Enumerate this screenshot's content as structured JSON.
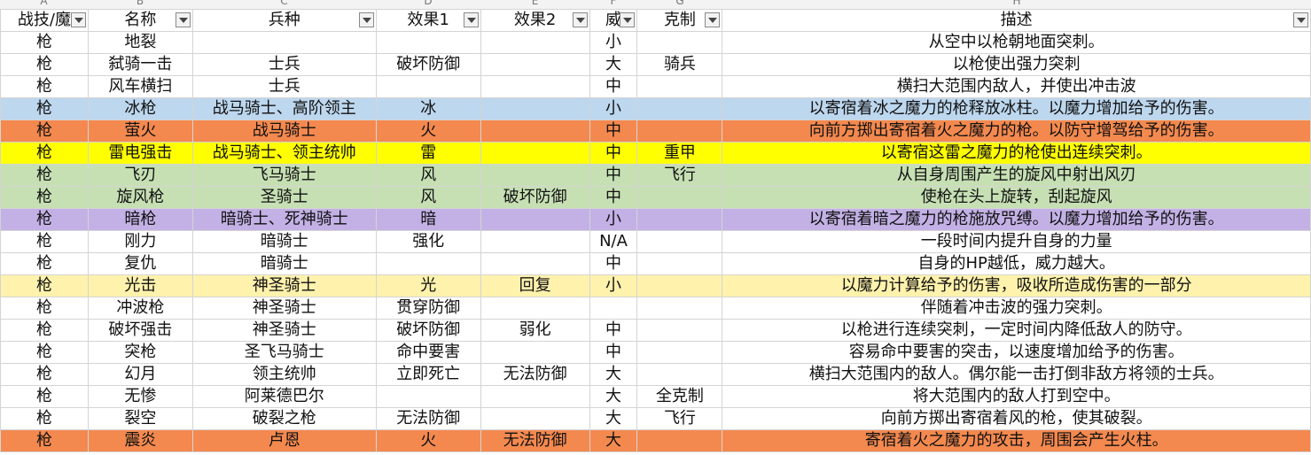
{
  "column_letters": [
    "A",
    "B",
    "C",
    "D",
    "E",
    "F",
    "G",
    "H"
  ],
  "headers": [
    "战技/魔",
    "名称",
    "兵种",
    "效果1",
    "效果2",
    "威",
    "克制",
    "描述"
  ],
  "rows": [
    {
      "cells": [
        "枪",
        "地裂",
        "",
        "",
        "",
        "小",
        "",
        "从空中以枪朝地面突刺。"
      ],
      "bg": "#ffffff"
    },
    {
      "cells": [
        "枪",
        "弑骑一击",
        "士兵",
        "破坏防御",
        "",
        "大",
        "骑兵",
        "以枪使出强力突刺"
      ],
      "bg": "#ffffff"
    },
    {
      "cells": [
        "枪",
        "风车横扫",
        "士兵",
        "",
        "",
        "中",
        "",
        "横扫大范围内敌人，并使出冲击波"
      ],
      "bg": "#ffffff"
    },
    {
      "cells": [
        "枪",
        "冰枪",
        "战马骑士、高阶领主",
        "冰",
        "",
        "小",
        "",
        "以寄宿着冰之魔力的枪释放冰柱。以魔力增加给予的伤害。"
      ],
      "bg": "#bdd7ee"
    },
    {
      "cells": [
        "枪",
        "萤火",
        "战马骑士",
        "火",
        "",
        "中",
        "",
        "向前方掷出寄宿着火之魔力的枪。以防守增驾给予的伤害。"
      ],
      "bg": "#f4894f"
    },
    {
      "cells": [
        "枪",
        "雷电强击",
        "战马骑士、领主统帅",
        "雷",
        "",
        "中",
        "重甲",
        "以寄宿这雷之魔力的枪使出连续突刺。"
      ],
      "bg": "#ffff00"
    },
    {
      "cells": [
        "枪",
        "飞刃",
        "飞马骑士",
        "风",
        "",
        "中",
        "飞行",
        "从自身周围产生的旋风中射出风刃"
      ],
      "bg": "#c6e0b4"
    },
    {
      "cells": [
        "枪",
        "旋风枪",
        "圣骑士",
        "风",
        "破坏防御",
        "中",
        "",
        "使枪在头上旋转，刮起旋风"
      ],
      "bg": "#c6e0b4"
    },
    {
      "cells": [
        "枪",
        "暗枪",
        "暗骑士、死神骑士",
        "暗",
        "",
        "小",
        "",
        "以寄宿着暗之魔力的枪施放咒缚。以魔力增加给予的伤害。"
      ],
      "bg": "#c3b1e6"
    },
    {
      "cells": [
        "枪",
        "刚力",
        "暗骑士",
        "强化",
        "",
        "N/A",
        "",
        "一段时间内提升自身的力量"
      ],
      "bg": "#ffffff"
    },
    {
      "cells": [
        "枪",
        "复仇",
        "暗骑士",
        "",
        "",
        "中",
        "",
        "自身的HP越低，威力越大。"
      ],
      "bg": "#ffffff"
    },
    {
      "cells": [
        "枪",
        "光击",
        "神圣骑士",
        "光",
        "回复",
        "小",
        "",
        "以魔力计算给予的伤害，吸收所造成伤害的一部分"
      ],
      "bg": "#fff2ad"
    },
    {
      "cells": [
        "枪",
        "冲波枪",
        "神圣骑士",
        "贯穿防御",
        "",
        "",
        "",
        "伴随着冲击波的强力突刺。"
      ],
      "bg": "#ffffff"
    },
    {
      "cells": [
        "枪",
        "破坏强击",
        "神圣骑士",
        "破坏防御",
        "弱化",
        "中",
        "",
        "以枪进行连续突刺，一定时间内降低敌人的防守。"
      ],
      "bg": "#ffffff"
    },
    {
      "cells": [
        "枪",
        "突枪",
        "圣飞马骑士",
        "命中要害",
        "",
        "中",
        "",
        "容易命中要害的突击，以速度增加给予的伤害。"
      ],
      "bg": "#ffffff"
    },
    {
      "cells": [
        "枪",
        "幻月",
        "领主统帅",
        "立即死亡",
        "无法防御",
        "大",
        "",
        "横扫大范围内的敌人。偶尔能一击打倒非敌方将领的士兵。"
      ],
      "bg": "#ffffff"
    },
    {
      "cells": [
        "枪",
        "无惨",
        "阿莱德巴尔",
        "",
        "",
        "大",
        "全克制",
        "将大范围内的敌人打到空中。"
      ],
      "bg": "#ffffff"
    },
    {
      "cells": [
        "枪",
        "裂空",
        "破裂之枪",
        "无法防御",
        "",
        "大",
        "飞行",
        "向前方掷出寄宿着风的枪，使其破裂。"
      ],
      "bg": "#ffffff"
    },
    {
      "cells": [
        "枪",
        "震炎",
        "卢恩",
        "火",
        "无法防御",
        "大",
        "",
        "寄宿着火之魔力的攻击，周围会产生火柱。"
      ],
      "bg": "#f4894f"
    }
  ]
}
